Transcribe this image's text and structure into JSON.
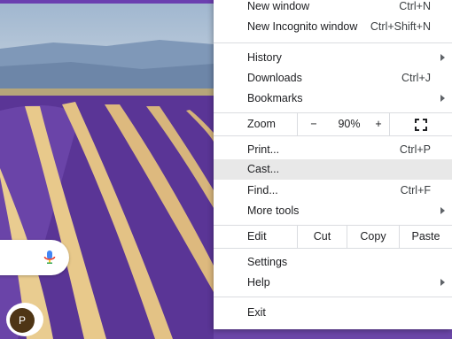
{
  "menu": {
    "new_window": {
      "label": "New window",
      "shortcut": "Ctrl+N"
    },
    "new_incognito": {
      "label": "New Incognito window",
      "shortcut": "Ctrl+Shift+N"
    },
    "history": {
      "label": "History"
    },
    "downloads": {
      "label": "Downloads",
      "shortcut": "Ctrl+J"
    },
    "bookmarks": {
      "label": "Bookmarks"
    },
    "zoom": {
      "label": "Zoom",
      "minus": "−",
      "level": "90%",
      "plus": "+"
    },
    "print": {
      "label": "Print...",
      "shortcut": "Ctrl+P"
    },
    "cast": {
      "label": "Cast..."
    },
    "find": {
      "label": "Find...",
      "shortcut": "Ctrl+F"
    },
    "more_tools": {
      "label": "More tools"
    },
    "edit": {
      "label": "Edit",
      "cut": "Cut",
      "copy": "Copy",
      "paste": "Paste"
    },
    "settings": {
      "label": "Settings"
    },
    "help": {
      "label": "Help"
    },
    "exit": {
      "label": "Exit"
    }
  },
  "avatar": {
    "initial": "P"
  },
  "colors": {
    "accent": "#6b3fb0",
    "avatar_bg": "#4e3515",
    "hover": "#e8e8e8"
  }
}
